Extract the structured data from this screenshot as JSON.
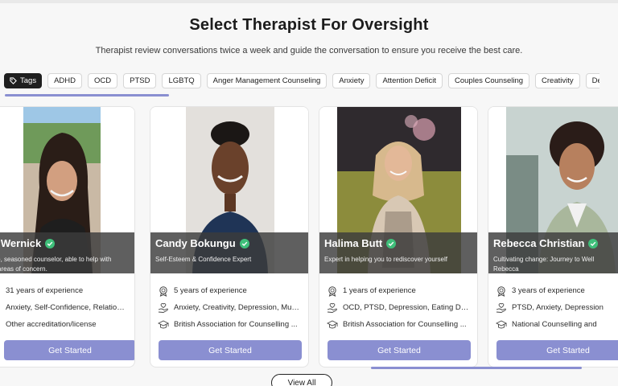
{
  "header": {
    "title": "Select Therapist For Oversight",
    "subtitle": "Therapist review conversations twice a week and guide the conversation to ensure you receive the best care."
  },
  "tags": {
    "label": "Tags",
    "items": [
      "ADHD",
      "OCD",
      "PTSD",
      "LGBTQ",
      "Anger Management Counseling",
      "Anxiety",
      "Attention Deficit",
      "Couples Counseling",
      "Creativity",
      "Depre"
    ]
  },
  "therapists": [
    {
      "name": "ra Wernick",
      "tagline_1": "nate, seasoned counselor, able to help with",
      "tagline_2": "areas of concern.",
      "experience": "31 years of experience",
      "specialties": "Anxiety, Self-Confidence, Relations...",
      "accreditation": "Other accreditation/license",
      "cta": "Get Started"
    },
    {
      "name": "Candy Bokungu",
      "tagline_1": "Self-Esteem & Confidence Expert",
      "tagline_2": "",
      "experience": "5 years of experience",
      "specialties": "Anxiety, Creativity, Depression, Multi...",
      "accreditation": "British Association for Counselling ...",
      "cta": "Get Started"
    },
    {
      "name": "Halima Butt",
      "tagline_1": "Expert in helping you to rediscover yourself",
      "tagline_2": "",
      "experience": "1 years of experience",
      "specialties": "OCD, PTSD, Depression, Eating Disor...",
      "accreditation": "British Association for Counselling ...",
      "cta": "Get Started"
    },
    {
      "name": "Rebecca Christian",
      "tagline_1": "Cultivating change: Journey to Well",
      "tagline_2": "Rebecca",
      "experience": "3 years of experience",
      "specialties": "PTSD, Anxiety, Depression",
      "accreditation": "National Counselling and",
      "cta": "Get Started"
    }
  ],
  "footer": {
    "view_all": "View All"
  },
  "colors": {
    "accent": "#8a8fd1",
    "verified": "#3fbf7a",
    "band": "#3c3c3c"
  }
}
